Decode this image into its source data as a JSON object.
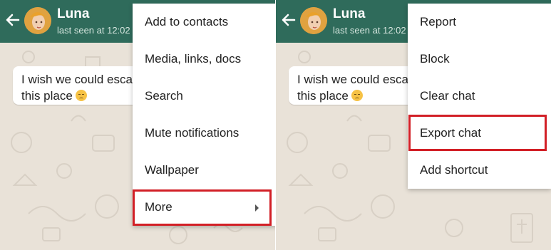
{
  "left_panel": {
    "contact_name": "Luna",
    "last_seen": "last seen at 12:02",
    "message": {
      "line1": "I wish we could esca",
      "line2": "this place"
    },
    "menu_items": [
      {
        "label": "Add to contacts"
      },
      {
        "label": "Media, links, docs"
      },
      {
        "label": "Search"
      },
      {
        "label": "Mute notifications"
      },
      {
        "label": "Wallpaper"
      },
      {
        "label": "More",
        "has_submenu": true,
        "highlighted": true
      }
    ]
  },
  "right_panel": {
    "contact_name": "Luna",
    "last_seen": "last seen at 12:02",
    "message": {
      "line1": "I wish we could esca",
      "line2": "this place"
    },
    "menu_items": [
      {
        "label": "Report"
      },
      {
        "label": "Block"
      },
      {
        "label": "Clear chat"
      },
      {
        "label": "Export chat",
        "highlighted": true
      },
      {
        "label": "Add shortcut"
      }
    ]
  },
  "colors": {
    "header_green": "#2f6b5b",
    "highlight_red": "#d21f26",
    "chat_background": "#e9e2d8"
  },
  "icons": [
    "back-arrow-icon",
    "avatar",
    "sad-face-emoji-icon",
    "submenu-arrow-icon"
  ]
}
